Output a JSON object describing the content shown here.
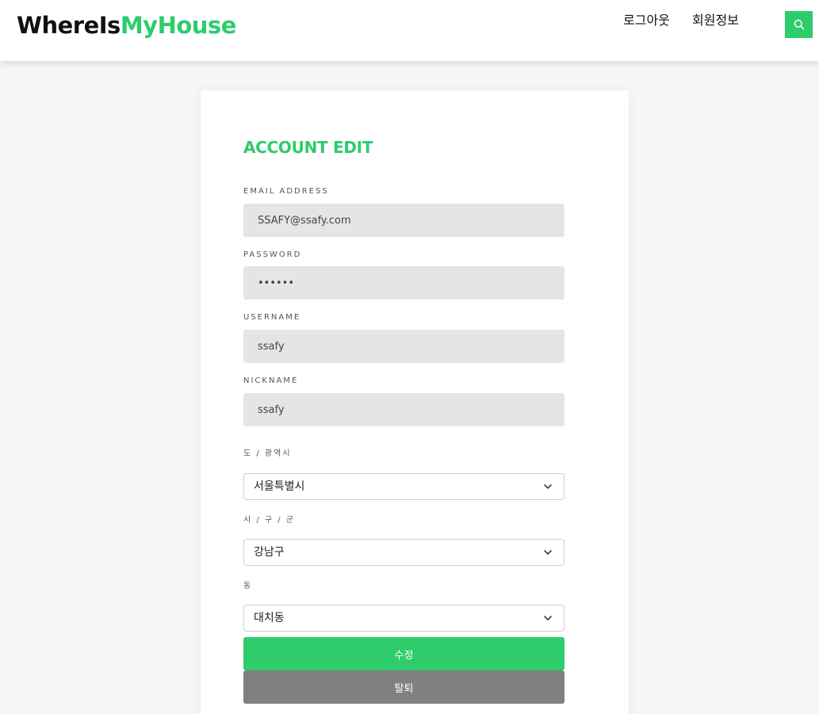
{
  "header": {
    "logo_part1": "WhereIs",
    "logo_part2": "MyHouse",
    "nav": {
      "logout": "로그아웃",
      "member_info": "회원정보"
    },
    "search_icon": "search-icon"
  },
  "form": {
    "title": "ACCOUNT EDIT",
    "email": {
      "label": "EMAIL ADDRESS",
      "value": "SSAFY@ssafy.com"
    },
    "password": {
      "label": "PASSWORD",
      "value": "••••••"
    },
    "username": {
      "label": "USERNAME",
      "value": "ssafy"
    },
    "nickname": {
      "label": "NICKNAME",
      "value": "ssafy"
    },
    "province": {
      "label": "도 / 광역시",
      "selected": "서울특별시"
    },
    "district": {
      "label": "시 / 구 / 군",
      "selected": "강남구"
    },
    "dong": {
      "label": "동",
      "selected": "대치동"
    },
    "edit_button": "수정",
    "withdraw_button": "탈퇴"
  },
  "colors": {
    "accent": "#2ecc6b",
    "withdraw": "#808080",
    "input_bg": "#e5e5e5"
  }
}
